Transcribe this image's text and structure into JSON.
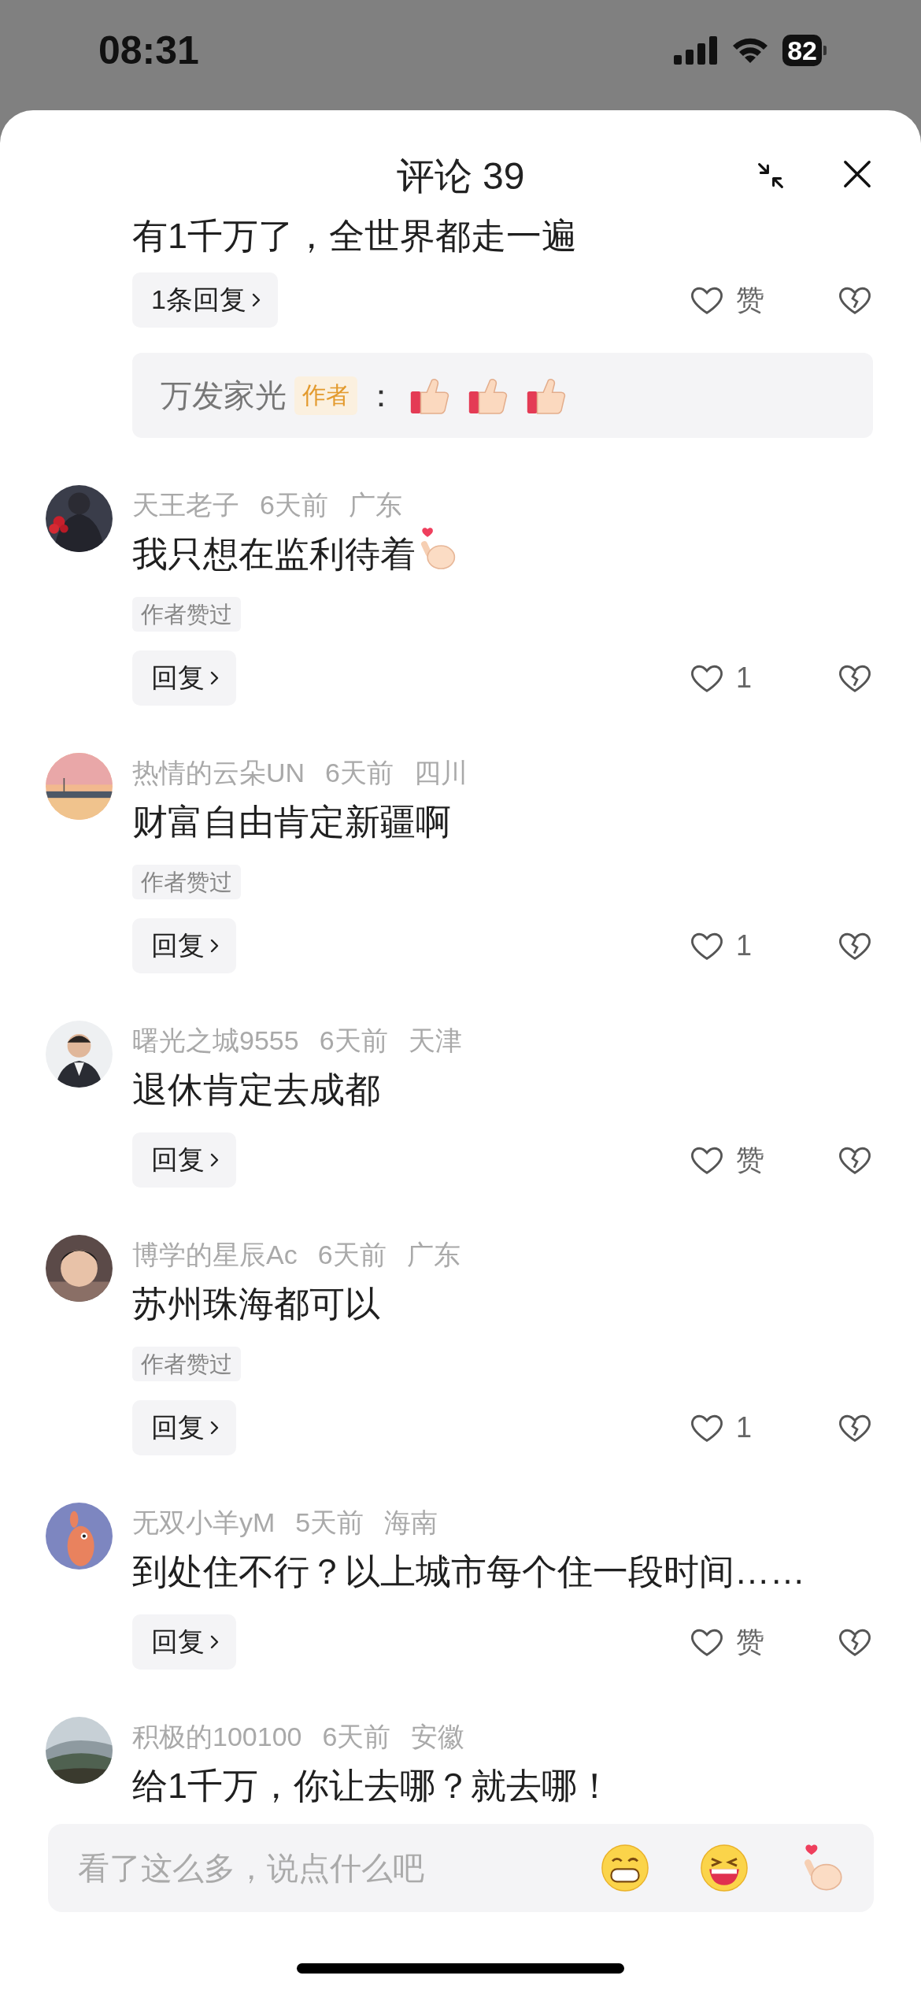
{
  "status_bar": {
    "time": "08:31",
    "battery": "82"
  },
  "header": {
    "title": "评论 39"
  },
  "partial_comment": {
    "text": "有1千万了，全世界都走一遍",
    "reply_button": "1条回复",
    "likes": "赞",
    "author_reply": {
      "name": "万发家光",
      "badge": "作者",
      "separator": "：",
      "stickers": [
        {
          "kind": "thumbs-up"
        },
        {
          "kind": "thumbs-up"
        },
        {
          "kind": "thumbs-up"
        }
      ]
    }
  },
  "comments": [
    {
      "user": "天王老子",
      "time": "6天前",
      "location": "广东",
      "text": "我只想在监利待着",
      "trailing_icon": {
        "kind": "finger-heart"
      },
      "author_liked": "作者赞过",
      "reply_button": "回复",
      "likes": "1"
    },
    {
      "user": "热情的云朵UN",
      "time": "6天前",
      "location": "四川",
      "text": "财富自由肯定新疆啊",
      "author_liked": "作者赞过",
      "reply_button": "回复",
      "likes": "1"
    },
    {
      "user": "曙光之城9555",
      "time": "6天前",
      "location": "天津",
      "text": "退休肯定去成都",
      "reply_button": "回复",
      "likes": "赞"
    },
    {
      "user": "博学的星辰Ac",
      "time": "6天前",
      "location": "广东",
      "text": "苏州珠海都可以",
      "author_liked": "作者赞过",
      "reply_button": "回复",
      "likes": "1"
    },
    {
      "user": "无双小羊yM",
      "time": "5天前",
      "location": "海南",
      "text": "到处住不行？以上城市每个住一段时间……",
      "reply_button": "回复",
      "likes": "赞"
    },
    {
      "user": "积极的100100",
      "time": "6天前",
      "location": "安徽",
      "text": "给1千万，你让去哪？就去哪！"
    }
  ],
  "input": {
    "placeholder": "看了这么多，说点什么吧",
    "emojis": [
      {
        "kind": "grin"
      },
      {
        "kind": "laugh"
      },
      {
        "kind": "finger-heart"
      }
    ]
  }
}
